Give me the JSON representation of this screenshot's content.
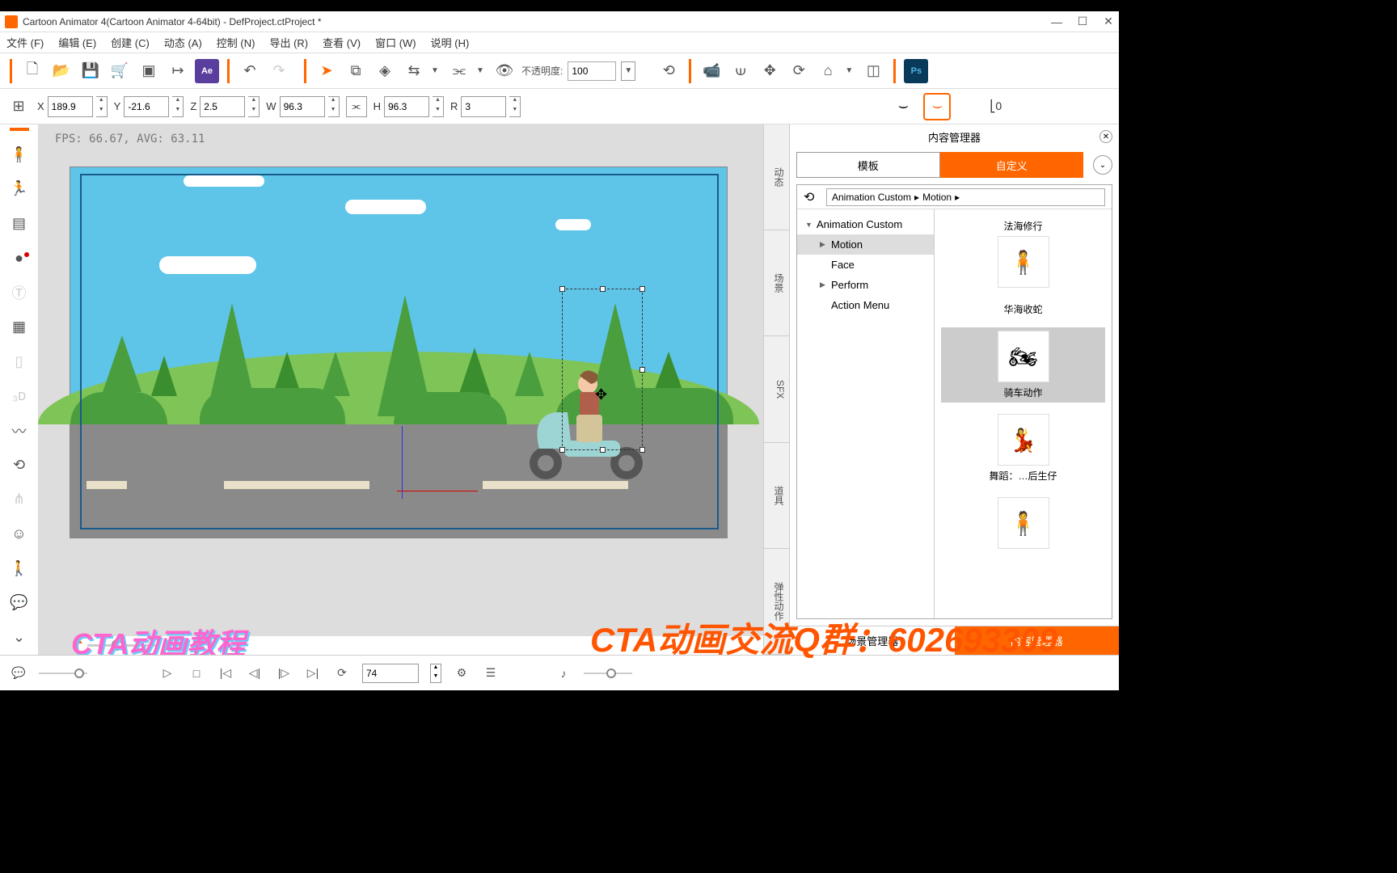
{
  "titlebar": {
    "title": "Cartoon Animator 4(Cartoon Animator 4-64bit) - DefProject.ctProject *"
  },
  "menubar": {
    "file": "文件 (F)",
    "edit": "编辑 (E)",
    "create": "创建 (C)",
    "animate": "动态 (A)",
    "control": "控制 (N)",
    "export": "导出 (R)",
    "view": "查看 (V)",
    "window": "窗口 (W)",
    "help": "说明 (H)"
  },
  "toolbar1": {
    "opacity_label": "不透明度:",
    "opacity_value": "100",
    "ae": "Ae",
    "ps": "Ps"
  },
  "transform": {
    "x_label": "X",
    "x": "189.9",
    "y_label": "Y",
    "y": "-21.6",
    "z_label": "Z",
    "z": "2.5",
    "w_label": "W",
    "w": "96.3",
    "h_label": "H",
    "h": "96.3",
    "r_label": "R",
    "r": "3",
    "axis": "0"
  },
  "canvas": {
    "fps": "FPS: 66.67, AVG: 63.11"
  },
  "watermark": "CTA动画教程",
  "timeline": {
    "frame": "74"
  },
  "content_manager": {
    "title": "内容管理器",
    "tab_template": "模板",
    "tab_custom": "自定义",
    "breadcrumb1": "Animation Custom",
    "breadcrumb2": "Motion",
    "tree": {
      "root": "Animation Custom",
      "motion": "Motion",
      "face": "Face",
      "perform": "Perform",
      "action_menu": "Action Menu"
    },
    "thumbs": {
      "t1": "法海修行",
      "t2": "华海收蛇",
      "t3": "骑车动作",
      "t4": "舞蹈：…后生仔"
    }
  },
  "vtabs": {
    "dynamic": "动态",
    "scene": "场景",
    "sfx": "SFX",
    "props": "道具",
    "elastic": "弹性动作"
  },
  "bottom_tabs": {
    "scene_mgr": "场景管理器",
    "content_mgr": "内容管理器"
  },
  "overlay": "CTA动画交流Q群：602693309"
}
